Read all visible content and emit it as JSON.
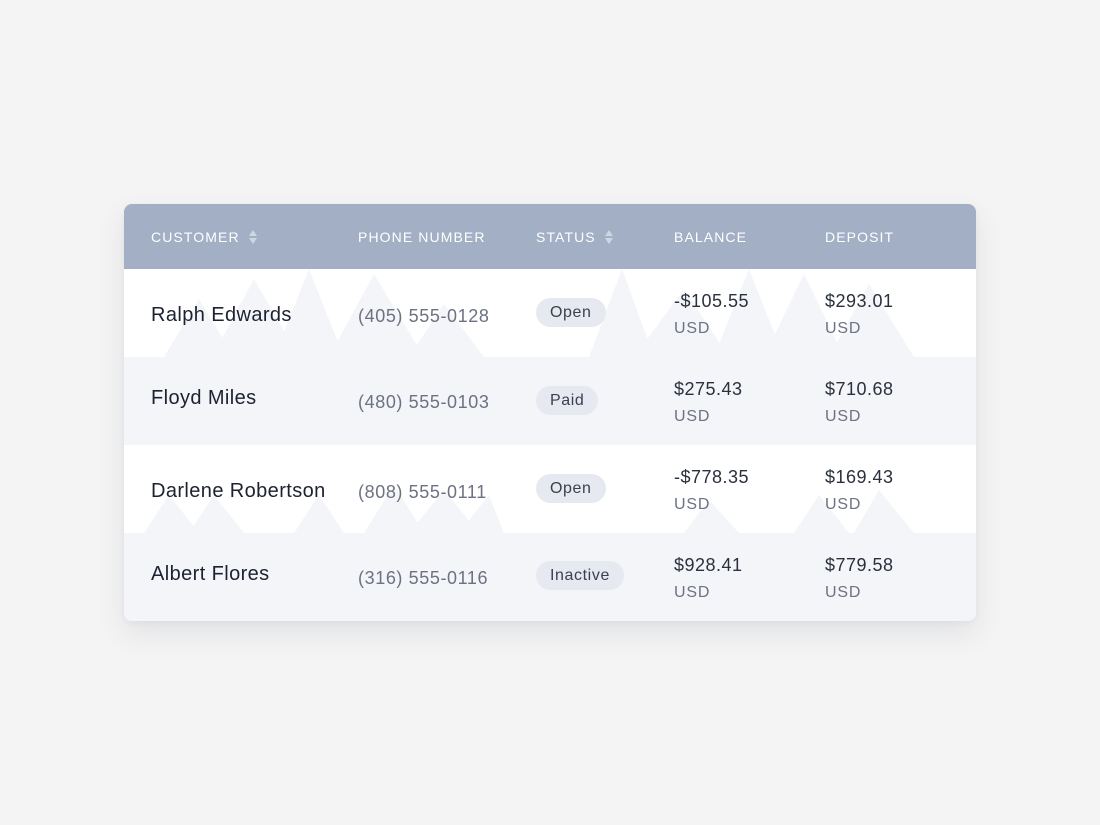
{
  "table": {
    "columns": [
      {
        "label": "CUSTOMER",
        "sortable": true
      },
      {
        "label": "PHONE NUMBER",
        "sortable": false
      },
      {
        "label": "STATUS",
        "sortable": true
      },
      {
        "label": "BALANCE",
        "sortable": false
      },
      {
        "label": "DEPOSIT",
        "sortable": false
      }
    ],
    "rows": [
      {
        "customer": "Ralph Edwards",
        "phone": "(405) 555-0128",
        "status": "Open",
        "balance": "-$105.55",
        "balance_currency": "USD",
        "deposit": "$293.01",
        "deposit_currency": "USD"
      },
      {
        "customer": "Floyd Miles",
        "phone": "(480) 555-0103",
        "status": "Paid",
        "balance": "$275.43",
        "balance_currency": "USD",
        "deposit": "$710.68",
        "deposit_currency": "USD"
      },
      {
        "customer": "Darlene Robertson",
        "phone": "(808) 555-0111",
        "status": "Open",
        "balance": "-$778.35",
        "balance_currency": "USD",
        "deposit": "$169.43",
        "deposit_currency": "USD"
      },
      {
        "customer": "Albert Flores",
        "phone": "(316) 555-0116",
        "status": "Inactive",
        "balance": "$928.41",
        "balance_currency": "USD",
        "deposit": "$779.58",
        "deposit_currency": "USD"
      }
    ]
  },
  "icons": {
    "sort": "sort-up-down-icon"
  },
  "colors": {
    "header_bg": "#a2afc5",
    "header_text": "#ffffff",
    "row_alt_bg": "#f4f5f8",
    "badge_bg": "#e6e9ef",
    "page_bg": "#f4f4f4"
  }
}
